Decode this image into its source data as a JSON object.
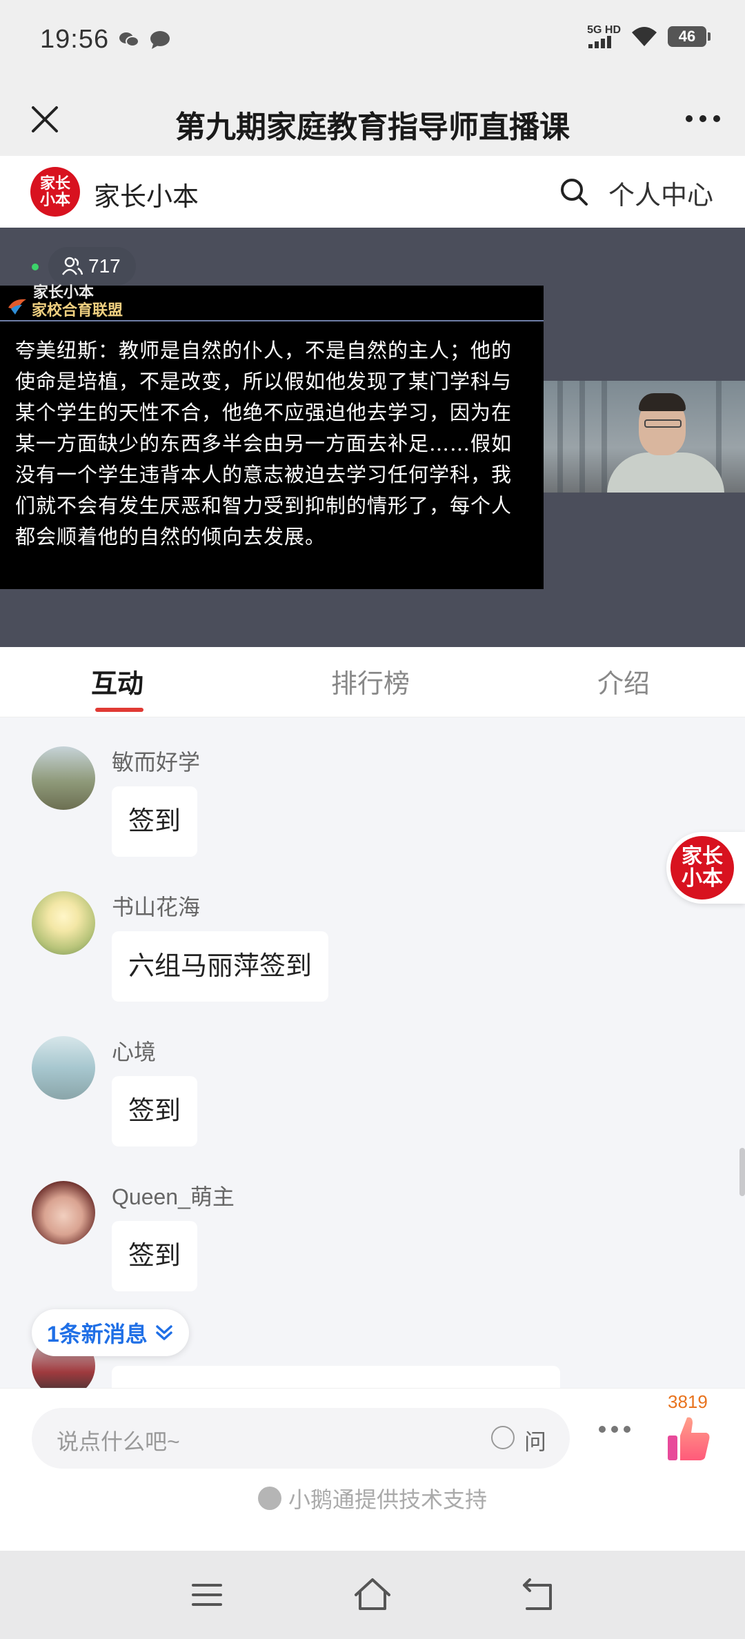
{
  "status_bar": {
    "time": "19:56",
    "left_icons": [
      "wechat-icon",
      "chat-bubble-icon"
    ],
    "network": "5G HD",
    "battery": "46"
  },
  "title_bar": {
    "title": "第九期家庭教育指导师直播课",
    "close_icon": "close-icon",
    "more_icon": "more-icon"
  },
  "brand_bar": {
    "logo_text": "家长小本",
    "name": "家长小本",
    "user_center": "个人中心"
  },
  "video": {
    "viewer_count": "717",
    "slide_brand": "家长小本",
    "slide_union": "家校合育联盟",
    "slide_text": "夸美纽斯：教师是自然的仆人，不是自然的主人；他的使命是培植，不是改变，所以假如他发现了某门学科与某个学生的天性不合，他绝不应强迫他去学习，因为在某一方面缺少的东西多半会由另一方面去补足……假如没有一个学生违背本人的意志被迫去学习任何学科，我们就不会有发生厌恶和智力受到抑制的情形了，每个人都会顺着他的自然的倾向去发展。"
  },
  "tabs": [
    {
      "label": "互动",
      "active": true
    },
    {
      "label": "排行榜",
      "active": false
    },
    {
      "label": "介绍",
      "active": false
    }
  ],
  "messages": [
    {
      "name": "敏而好学",
      "text": "签到"
    },
    {
      "name": "书山花海",
      "text": "六组马丽萍签到"
    },
    {
      "name": "心境",
      "text": "签到"
    },
    {
      "name": "Queen_萌主",
      "text": "签到"
    }
  ],
  "float_logo_text": "家长小本",
  "new_message_pill": "1条新消息",
  "input": {
    "placeholder": "说点什么吧~",
    "ask_label": "问",
    "like_count": "3819"
  },
  "powered_by": "小鹅通提供技术支持",
  "colors": {
    "brand_red": "#d8121f",
    "tab_underline": "#e03a34",
    "new_msg_blue": "#1f6fe6",
    "like_orange": "#e8731e"
  }
}
